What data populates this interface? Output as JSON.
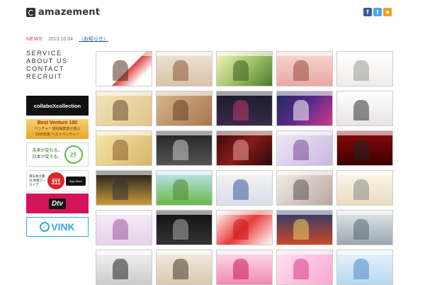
{
  "header": {
    "logo_text": "amazement",
    "social": [
      {
        "name": "facebook-icon",
        "glyph": "f"
      },
      {
        "name": "twitter-icon",
        "glyph": "t"
      },
      {
        "name": "favorite-star-icon",
        "glyph": "★"
      }
    ]
  },
  "news": {
    "label": "NEWS",
    "date": "2013.10.04",
    "link_text": "（お知らせ）"
  },
  "nav": {
    "items": [
      "SERVICE",
      "ABOUT US",
      "CONTACT",
      "RECRUIT"
    ]
  },
  "banners": {
    "collabo": "collaboXcollection",
    "bestventure_title": "Best Venture 100",
    "bestventure_sub": "ベンチャー通信編集部が選ぶ",
    "bestventure_sub2": "2008年度 ベストベンチャー",
    "challenge_line1": "未来が変わる。",
    "challenge_line2": "日本が変える。",
    "challenge_num": "25",
    "japan311_left": "東日本大震災 映像アーカイブ",
    "japan311_label": "JAPAN",
    "japan311_num": "311",
    "japan311_store": "App Store",
    "dtv": "Dtv",
    "vink": "VINK"
  },
  "colors": {
    "news_label": "#e0326e",
    "news_link": "#1a55b0"
  },
  "thumbnails": [
    {
      "bg": "linear-gradient(135deg,#ffffff 55%,#e04040 56%,#ffffff 80%)",
      "accent": "#553322"
    },
    {
      "bg": "linear-gradient(180deg,#efe4d8,#d9c2a8)",
      "accent": "#8b5a3c"
    },
    {
      "bg": "linear-gradient(135deg,#f7f5c0,#a3c46a,#4c7a2e)",
      "accent": "#3d5a22"
    },
    {
      "bg": "linear-gradient(180deg,#f8d7d0,#e8a9a4)",
      "accent": "#9a4b40"
    },
    {
      "bg": "linear-gradient(180deg,#ffffff,#f0ece8)",
      "accent": "#999999"
    },
    {
      "bg": "linear-gradient(135deg,#f2e4b8,#e0c48c)",
      "accent": "#6a4b2a"
    },
    {
      "bg": "linear-gradient(135deg,#d7b78f,#a8774f)",
      "accent": "#6b3f22"
    },
    {
      "bg": "linear-gradient(180deg,#1a1a2a,#3a2a4a)",
      "accent": "#c33a6a"
    },
    {
      "bg": "linear-gradient(135deg,#1c2c5a,#5a2a8a,#d33a8a)",
      "accent": "#ffffff"
    },
    {
      "bg": "linear-gradient(180deg,#ffffff,#e8e4e4)",
      "accent": "#333333"
    },
    {
      "bg": "linear-gradient(135deg,#f6e7a8,#d8b56a)",
      "accent": "#8a5a2a"
    },
    {
      "bg": "linear-gradient(180deg,#222222,#555555)",
      "accent": "#cccccc"
    },
    {
      "bg": "linear-gradient(135deg,#3a0a0a,#8a1a1a,#2a0a0a)",
      "accent": "#e6a0a0"
    },
    {
      "bg": "linear-gradient(135deg,#f0e8f4,#c8b8e0)",
      "accent": "#7a4a9a"
    },
    {
      "bg": "linear-gradient(180deg,#8a0a0a,#3a0000)",
      "accent": "#222222"
    },
    {
      "bg": "linear-gradient(180deg,#1a1a1a,#c89a3a)",
      "accent": "#333333"
    },
    {
      "bg": "linear-gradient(180deg,#bfe6f4,#6ab84a)",
      "accent": "#4a8a2a"
    },
    {
      "bg": "linear-gradient(180deg,#f4f4f4,#d8dde8)",
      "accent": "#3a5a9a"
    },
    {
      "bg": "linear-gradient(135deg,#f4eee8,#b8a8a0)",
      "accent": "#555555"
    },
    {
      "bg": "linear-gradient(180deg,#fdf8ec,#e8dcc0)",
      "accent": "#888888"
    },
    {
      "bg": "linear-gradient(180deg,#f8eef8,#e8d0ec)",
      "accent": "#9a5aa0"
    },
    {
      "bg": "linear-gradient(180deg,#111111,#333333)",
      "accent": "#aaaaaa"
    },
    {
      "bg": "linear-gradient(135deg,#ffffff,#e83a3a,#ffffff)",
      "accent": "#c81a1a"
    },
    {
      "bg": "linear-gradient(180deg,#2a3a6a,#c84a2a)",
      "accent": "#f4d060"
    },
    {
      "bg": "linear-gradient(180deg,#dfe8ec,#9aa8b0)",
      "accent": "#5a6a70"
    },
    {
      "bg": "linear-gradient(180deg,#f4f4f4,#cccccc)",
      "accent": "#222222"
    },
    {
      "bg": "linear-gradient(180deg,#f4eee4,#d8c8b0)",
      "accent": "#4a3a2a"
    },
    {
      "bg": "linear-gradient(180deg,#ffe0ec,#f08ab0)",
      "accent": "#c81a5a"
    },
    {
      "bg": "linear-gradient(135deg,#ffe4f0,#f8a8d0)",
      "accent": "#d83a8a"
    },
    {
      "bg": "linear-gradient(180deg,#eaf4fc,#b8d8f0)",
      "accent": "#4a8ac8"
    }
  ]
}
